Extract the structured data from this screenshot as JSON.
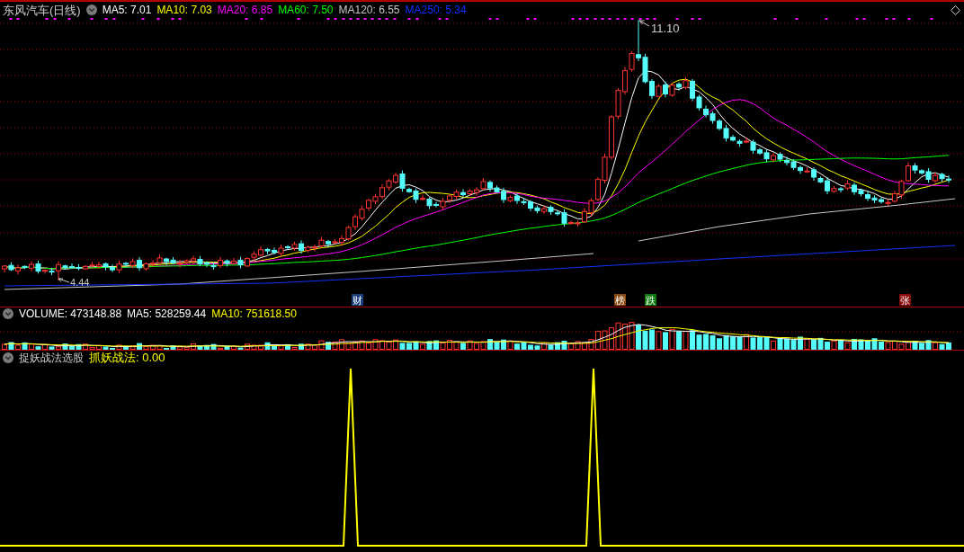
{
  "chart_header": {
    "title": "东风汽车(日线)",
    "indicators": [
      {
        "label": "MA5: 7.01",
        "color": "#ffffff"
      },
      {
        "label": "MA10: 7.03",
        "color": "#ffff00"
      },
      {
        "label": "MA20: 6.85",
        "color": "#ff00ff"
      },
      {
        "label": "MA60: 7.50",
        "color": "#00ff00"
      },
      {
        "label": "MA120: 6.55",
        "color": "#c8c8c8"
      },
      {
        "label": "MA250: 5.34",
        "color": "#1030ff"
      }
    ]
  },
  "price_labels": {
    "high": "11.10",
    "low": "4.44"
  },
  "event_markers": [
    {
      "label": "财",
      "color": "#1a3d7c"
    },
    {
      "label": "榜",
      "color": "#8b4a12"
    },
    {
      "label": "跌",
      "color": "#0e7a0e"
    },
    {
      "label": "张",
      "color": "#8b0a0a"
    }
  ],
  "volume_header": {
    "items": [
      {
        "label": "VOLUME: 473148.88",
        "color": "#ffffff"
      },
      {
        "label": "MA5: 528259.44",
        "color": "#ffffff"
      },
      {
        "label": "MA10: 751618.50",
        "color": "#ffff00"
      }
    ]
  },
  "indicator_header": {
    "title": "捉妖战法选股",
    "items": [
      {
        "label": "抓妖战法: 0.00",
        "color": "#ffff00"
      }
    ]
  }
}
